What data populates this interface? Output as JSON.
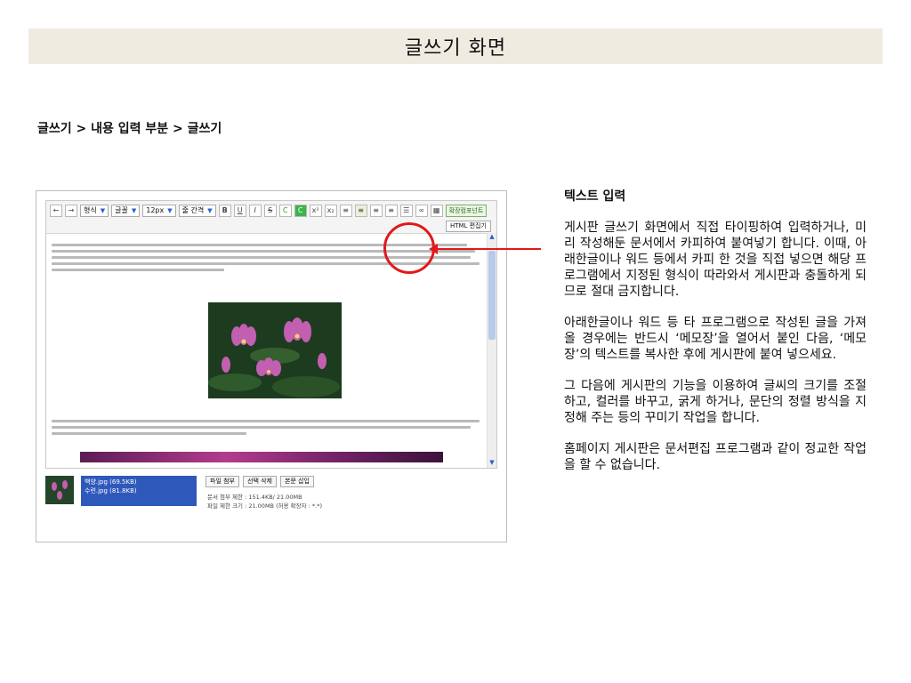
{
  "page": {
    "title": "글쓰기 화면",
    "breadcrumb": "글쓰기 > 내용 입력 부분 > 글쓰기"
  },
  "editor": {
    "toolbar": {
      "format_label": "형식",
      "font_label": "글꼴",
      "size_label": "12px",
      "line_height_label": "줄 간격",
      "extension_label": "확장컴포넌트",
      "html_edit_label": "HTML 편집기"
    }
  },
  "attachment": {
    "files": [
      "백양.jpg (69.5KB)",
      "수련.jpg (81.8KB)"
    ],
    "buttons": [
      "파일 첨부",
      "선택 삭제",
      "본문 삽입"
    ],
    "limit_note": "문서 첨부 제한 : 151.4KB/ 21.00MB",
    "size_note": "파일 제한 크기 : 21.00MB (허용 확장자 : *.*)"
  },
  "panel": {
    "heading": "텍스트 입력",
    "paragraphs": [
      "게시판 글쓰기 화면에서 직접 타이핑하여 입력하거나, 미리 작성해둔 문서에서 카피하여 붙여넣기 합니다. 이때, 아래한글이나 워드 등에서 카피 한 것을 직접 넣으면 해당 프로그램에서 지정된 형식이 따라와서 게시판과 충돌하게 되므로 절대 금지합니다.",
      "아래한글이나 워드 등 타 프로그램으로 작성된 글을 가져 올 경우에는 반드시 ‘메모장’을 열어서 붙인 다음, ‘메모장’의 텍스트를 복사한 후에 게시판에 붙여 넣으세요.",
      "그 다음에 게시판의 기능을 이용하여 글씨의 크기를 조절하고, 컬러를 바꾸고, 굵게 하거나, 문단의 정렬 방식을 지정해 주는 등의 꾸미기 작업을 합니다.",
      "홈페이지 게시판은 문서편집 프로그램과 같이 정교한 작업을 할 수 없습니다."
    ]
  },
  "colors": {
    "title_bar_bg": "#efebe1",
    "callout_red": "#e1191a"
  }
}
